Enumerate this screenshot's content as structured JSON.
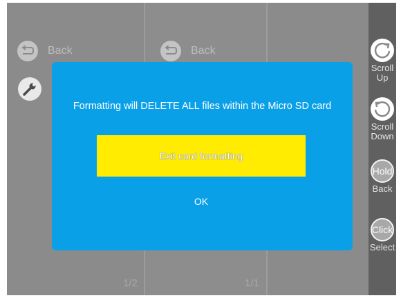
{
  "menu": {
    "panels": [
      {
        "back_label": "Back",
        "page_indicator": "1/2"
      },
      {
        "back_label": "Back",
        "page_indicator": "1/1"
      }
    ],
    "settings_icon": "wrench-icon"
  },
  "sidebar": {
    "scroll_up": {
      "line1": "Scroll",
      "line2": "Up"
    },
    "scroll_down": {
      "line1": "Scroll",
      "line2": "Down"
    },
    "hold": {
      "ring_text": "Hold",
      "label": "Back"
    },
    "click": {
      "ring_text": "Click",
      "label": "Select"
    }
  },
  "dialog": {
    "message": "Formatting will DELETE ALL files within the Micro SD card",
    "exit_button": "Exit card formatting",
    "ok_button": "OK"
  },
  "colors": {
    "dialog_bg": "#0aa0e8",
    "highlight": "#ffec00",
    "sidebar_bg": "#606060",
    "panel_bg": "#8b8b8b"
  }
}
